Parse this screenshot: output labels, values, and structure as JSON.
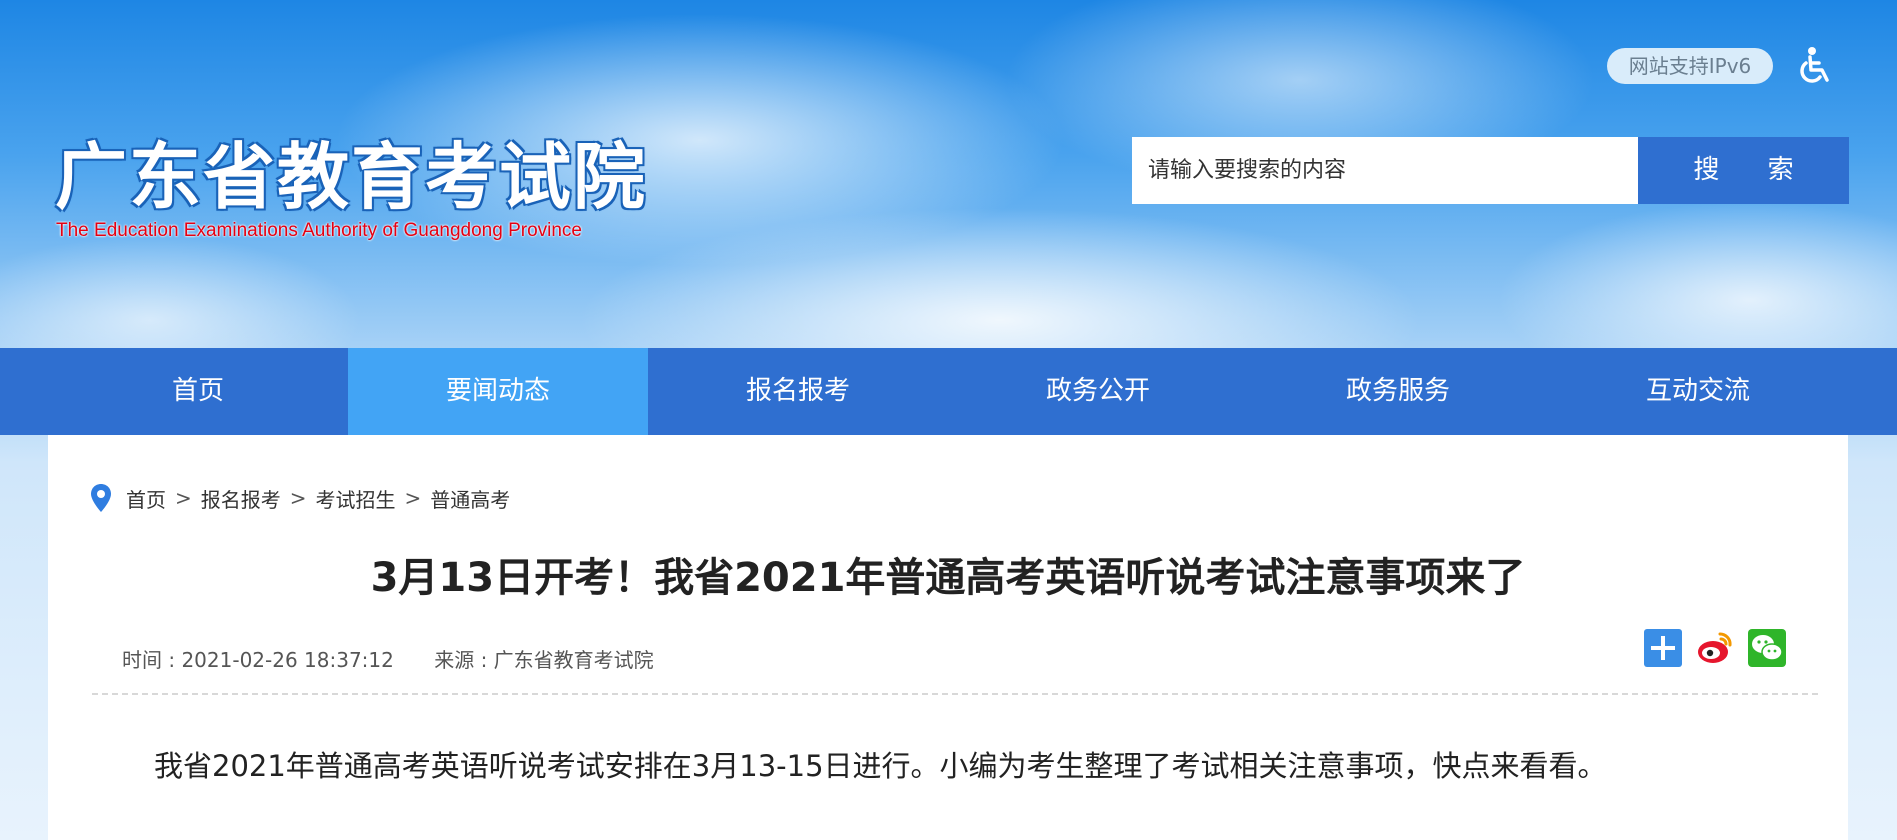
{
  "site": {
    "title_cn": "广东省教育考试院",
    "title_en": "The Education Examinations Authority of Guangdong Province",
    "ipv6_badge": "网站支持IPv6",
    "accessibility_icon": "wheelchair-icon"
  },
  "search": {
    "placeholder": "请输入要搜索的内容",
    "button_label": "搜 索"
  },
  "nav": {
    "items": [
      {
        "label": "首页"
      },
      {
        "label": "要闻动态"
      },
      {
        "label": "报名报考"
      },
      {
        "label": "政务公开"
      },
      {
        "label": "政务服务"
      },
      {
        "label": "互动交流"
      }
    ],
    "active_label": "要闻动态"
  },
  "breadcrumb": {
    "icon": "location-pin-icon",
    "items": [
      "首页",
      "报名报考",
      "考试招生",
      "普通高考"
    ],
    "separator": ">"
  },
  "article": {
    "title": "3月13日开考！我省2021年普通高考英语听说考试注意事项来了",
    "time": "时间 : 2021-02-26 18:37:12",
    "source": "来源 : 广东省教育考试院",
    "intro": "我省2021年普通高考英语听说考试安排在3月13-15日进行。小编为考生整理了考试相关注意事项，快点来看看。"
  },
  "share": {
    "icons": [
      "share-plus-icon",
      "weibo-icon",
      "wechat-icon"
    ]
  },
  "colors": {
    "nav_bg": "#2f6fd0",
    "nav_active": "#42a4f5",
    "search_button": "#2f6fd0",
    "logo_en": "#e60012"
  }
}
